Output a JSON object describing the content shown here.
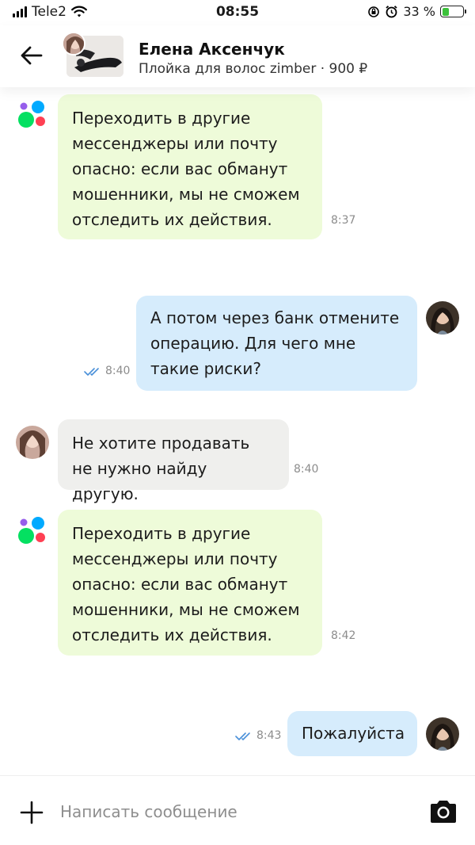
{
  "status_bar": {
    "carrier": "Tele2",
    "time": "08:55",
    "battery": "33 %",
    "battery_level": 0.33
  },
  "header": {
    "name": "Елена Аксенчук",
    "item_title": "Плойка для волос zimber",
    "price": "· 900 ₽",
    "back_icon": "arrow-left-icon"
  },
  "messages": [
    {
      "type": "system",
      "text": "Переходить в другие мессенджеры или почту опасно: если вас обманут мошенники, мы не сможем отследить их действия.",
      "time": "8:37"
    },
    {
      "type": "mine",
      "text": "А потом через банк отмените операцию. Для чего мне такие риски?",
      "time": "8:40"
    },
    {
      "type": "theirs",
      "text": "Не хотите продавать не нужно найду другую.",
      "time": "8:40"
    },
    {
      "type": "system",
      "text": "Переходить в другие мессенджеры или почту опасно: если вас обманут мошенники, мы не сможем отследить их действия.",
      "time": "8:42"
    },
    {
      "type": "mine",
      "text": "Пожалуйста",
      "time": "8:43"
    }
  ],
  "input": {
    "placeholder": "Написать сообщение",
    "value": "",
    "plus_icon": "plus-icon",
    "camera_icon": "camera-icon"
  },
  "colors": {
    "system_bubble": "#eefbd9",
    "mine_bubble": "#d6ecfc",
    "theirs_bubble": "#efefed",
    "read_ticks": "#4a90d9"
  }
}
